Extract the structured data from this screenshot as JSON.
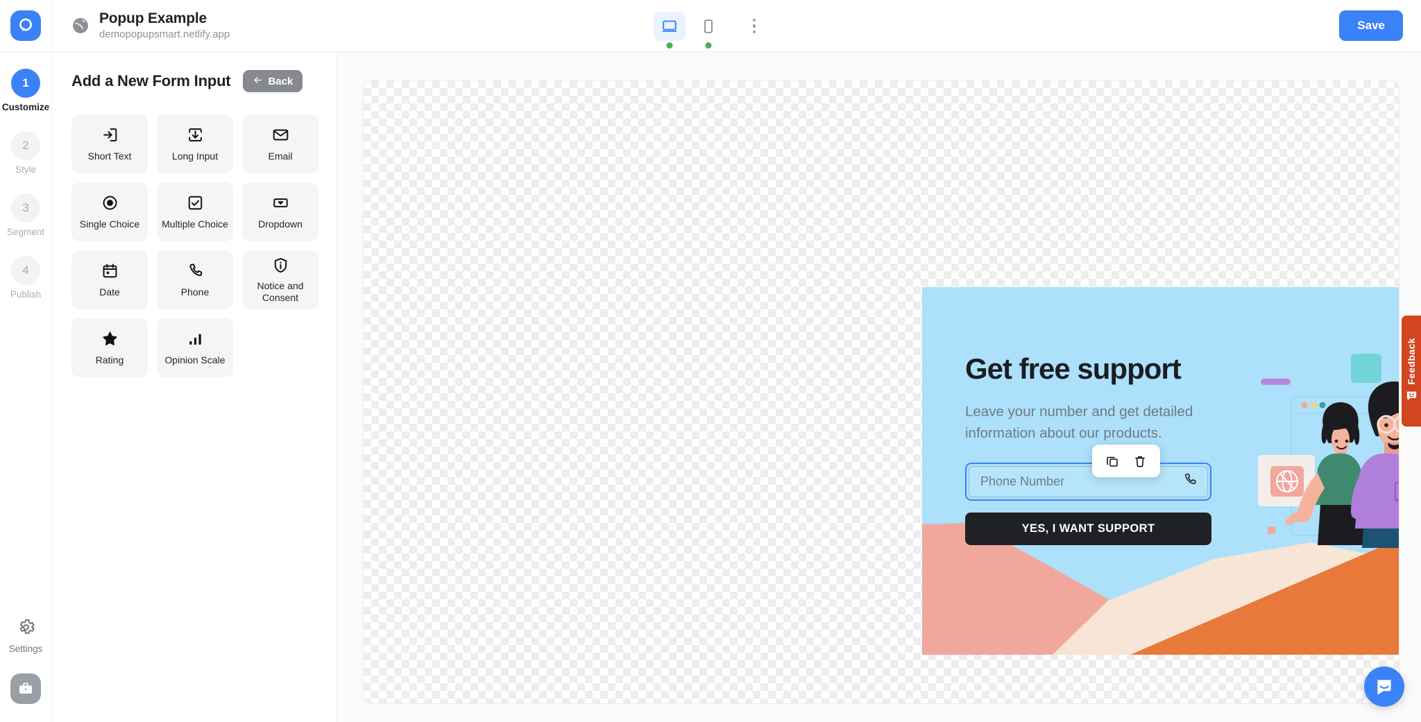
{
  "topbar": {
    "logo_icon": "popupsmart-logo-icon",
    "globe_icon": "globe-icon",
    "site_title": "Popup Example",
    "site_url": "demopopupsmart.netlify.app",
    "devices": [
      {
        "name": "desktop",
        "icon": "desktop-icon",
        "active": true,
        "status_color": "#4caf50"
      },
      {
        "name": "mobile",
        "icon": "mobile-icon",
        "active": false,
        "status_color": "#4caf50"
      }
    ],
    "more_icon": "kebab-menu-icon",
    "save_label": "Save",
    "accent_color": "#3b82f6"
  },
  "rail": {
    "steps": [
      {
        "number": "1",
        "label": "Customize",
        "active": true
      },
      {
        "number": "2",
        "label": "Style",
        "active": false
      },
      {
        "number": "3",
        "label": "Segment",
        "active": false
      },
      {
        "number": "4",
        "label": "Publish",
        "active": false
      }
    ],
    "settings_label": "Settings",
    "settings_icon": "gear-icon",
    "briefcase_icon": "briefcase-icon"
  },
  "panel": {
    "title": "Add a New Form Input",
    "back_label": "Back",
    "back_icon": "arrow-left-icon",
    "cards": [
      {
        "label": "Short Text",
        "icon": "short-text-icon"
      },
      {
        "label": "Long Input",
        "icon": "long-input-icon"
      },
      {
        "label": "Email",
        "icon": "envelope-icon"
      },
      {
        "label": "Single Choice",
        "icon": "radio-button-icon"
      },
      {
        "label": "Multiple Choice",
        "icon": "checkbox-icon"
      },
      {
        "label": "Dropdown",
        "icon": "dropdown-icon"
      },
      {
        "label": "Date",
        "icon": "calendar-icon"
      },
      {
        "label": "Phone",
        "icon": "phone-icon"
      },
      {
        "label": "Notice and Consent",
        "icon": "shield-info-icon"
      },
      {
        "label": "Rating",
        "icon": "star-icon"
      },
      {
        "label": "Opinion Scale",
        "icon": "bar-chart-icon"
      }
    ]
  },
  "popup": {
    "background_color": "#ace0fb",
    "close_icon": "close-icon",
    "heading": "Get free support",
    "body": "Leave your number and get detailed information about our products.",
    "phone_input": {
      "placeholder": "Phone Number",
      "value": "",
      "icon": "phone-icon",
      "selected": true,
      "selection_color": "#3b82f6"
    },
    "cta_label": "YES, I WANT SUPPORT",
    "cta_color": "#1f2124",
    "toolbar": {
      "duplicate_icon": "copy-icon",
      "delete_icon": "trash-icon"
    },
    "illustration": {
      "name": "support-team-illustration",
      "wave_colors": [
        "#f2a79d",
        "#f7e5d5",
        "#e8793a"
      ],
      "person_shirt_colors": [
        "#3f8a6e",
        "#b07fdb",
        "#7ed9dd"
      ]
    }
  },
  "feedback": {
    "label": "Feedback",
    "icon": "smiley-face-icon",
    "color": "#d1451f"
  },
  "intercom": {
    "icon": "chat-bubble-icon",
    "color": "#3b82f6"
  }
}
